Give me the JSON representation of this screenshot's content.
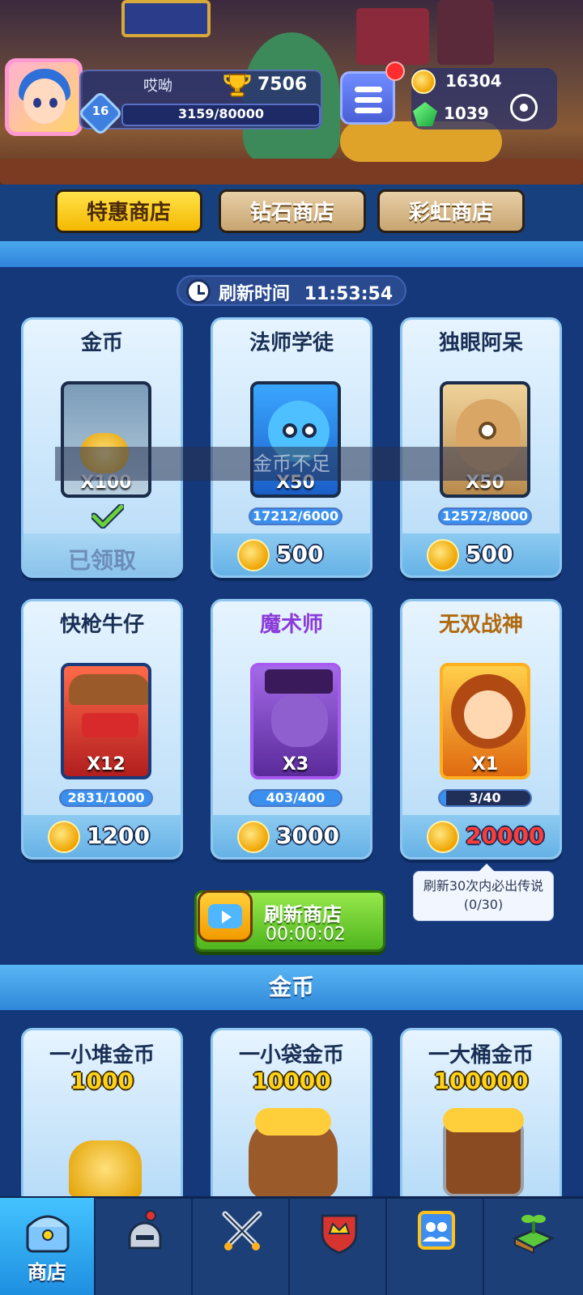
{
  "header": {
    "player_name": "哎呦",
    "level": "16",
    "trophies": "7506",
    "xp": "3159/80000",
    "coins": "16304",
    "gems": "1039"
  },
  "tabs": [
    {
      "label": "特惠商店",
      "active": true
    },
    {
      "label": "钻石商店",
      "active": false
    },
    {
      "label": "彩虹商店",
      "active": false
    }
  ],
  "daily": {
    "refresh_label": "刷新时间",
    "refresh_time": "11:53:54",
    "insufficient_toast": "金币不足"
  },
  "items": [
    {
      "title": "金币",
      "qty": "X100",
      "status": "已领取"
    },
    {
      "title": "法师学徒",
      "qty": "X50",
      "progress": "17212/6000",
      "progress_fraction": 1.0,
      "price": "500"
    },
    {
      "title": "独眼阿呆",
      "qty": "X50",
      "progress": "12572/8000",
      "progress_fraction": 1.0,
      "price": "500"
    },
    {
      "title": "快枪牛仔",
      "qty": "X12",
      "progress": "2831/1000",
      "progress_fraction": 1.0,
      "price": "1200"
    },
    {
      "title": "魔术师",
      "qty": "X3",
      "progress": "403/400",
      "progress_fraction": 1.0,
      "price": "3000"
    },
    {
      "title": "无双战神",
      "qty": "X1",
      "progress": "3/40",
      "progress_fraction": 0.075,
      "price": "20000"
    }
  ],
  "tooltip": {
    "line1": "刷新30次内必出传说",
    "line2": "(0/30)"
  },
  "refresh_button": {
    "label": "刷新商店",
    "timer": "00:00:02"
  },
  "gold_section": {
    "title": "金币",
    "packs": [
      {
        "name": "一小堆金币",
        "amount": "1000"
      },
      {
        "name": "一小袋金币",
        "amount": "10000"
      },
      {
        "name": "一大桶金币",
        "amount": "100000"
      }
    ]
  },
  "bottom_nav": [
    {
      "label": "商店",
      "icon": "shop-chest-icon",
      "active": true
    },
    {
      "label": "",
      "icon": "knight-helmet-icon",
      "active": false
    },
    {
      "label": "",
      "icon": "crossed-swords-icon",
      "active": false
    },
    {
      "label": "",
      "icon": "crown-shield-icon",
      "active": false
    },
    {
      "label": "",
      "icon": "team-banner-icon",
      "active": false
    },
    {
      "label": "",
      "icon": "sprout-island-icon",
      "active": false
    }
  ],
  "colors": {
    "accent_yellow": "#f5b800",
    "price_red": "#ff3b3b",
    "refresh_green": "#4fb51e",
    "background_blue": "#14387a"
  }
}
